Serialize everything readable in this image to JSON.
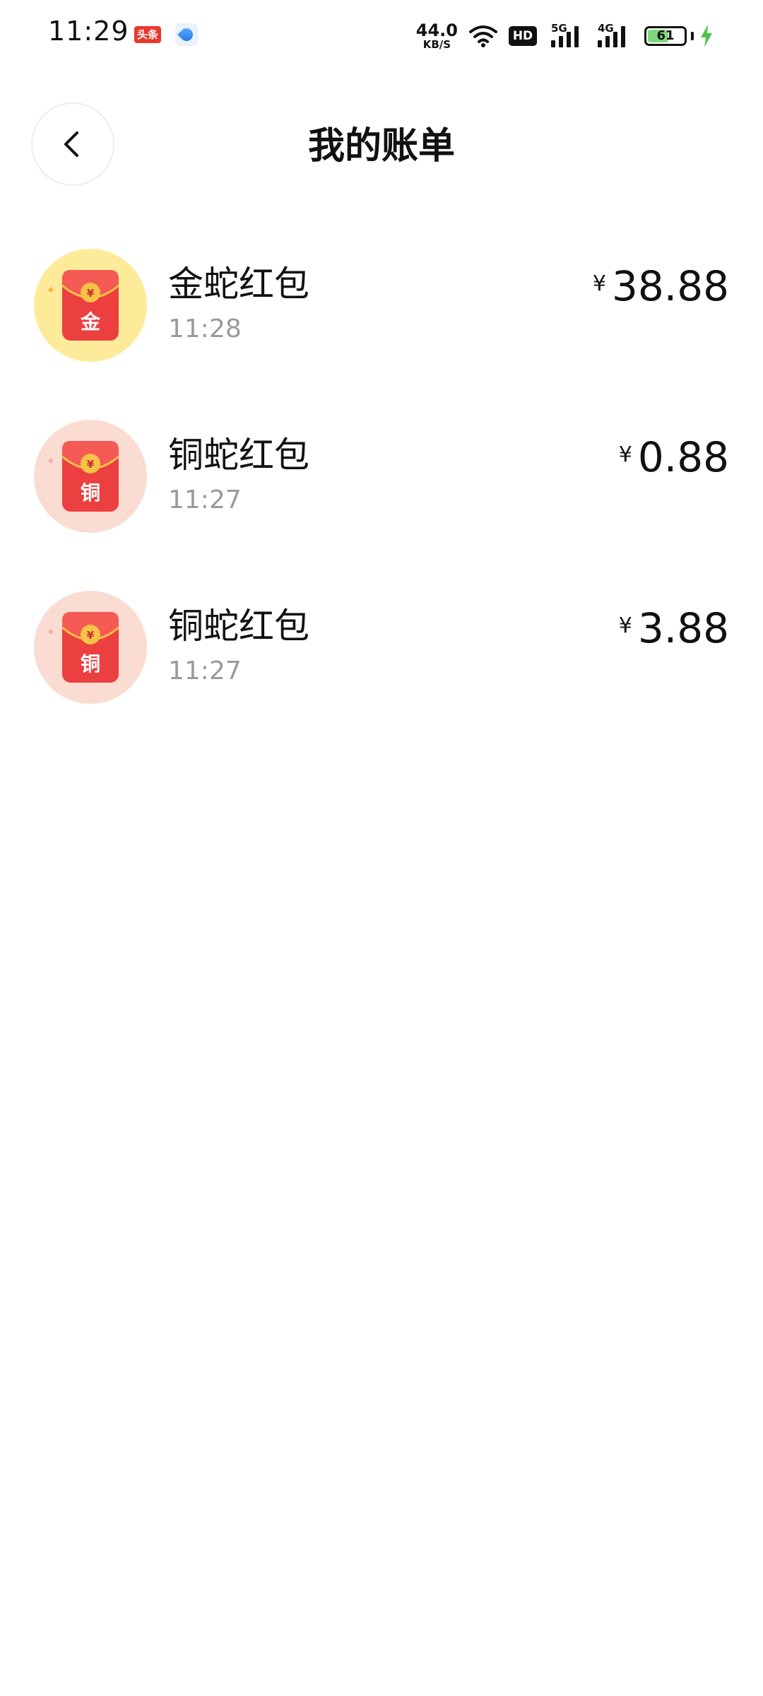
{
  "status_bar": {
    "time": "11:29",
    "news_app_label": "头条",
    "net_speed_value": "44.0",
    "net_speed_unit": "KB/S",
    "hd_label": "HD",
    "signal_1_label": "5G",
    "signal_2_label": "4G",
    "battery_level": "61",
    "battery_fraction": 0.61,
    "charging": true
  },
  "header": {
    "title": "我的账单"
  },
  "bills": [
    {
      "name": "金蛇红包",
      "time": "11:28",
      "currency": "¥",
      "amount": "38.88",
      "badge_char": "金",
      "icon_name": "gold-red-packet-icon",
      "bg_color": "#fdeb9a"
    },
    {
      "name": "铜蛇红包",
      "time": "11:27",
      "currency": "¥",
      "amount": "0.88",
      "badge_char": "铜",
      "icon_name": "copper-red-packet-icon",
      "bg_color": "#fbdcd2"
    },
    {
      "name": "铜蛇红包",
      "time": "11:27",
      "currency": "¥",
      "amount": "3.88",
      "badge_char": "铜",
      "icon_name": "copper-red-packet-icon",
      "bg_color": "#fbdcd2"
    }
  ],
  "colors": {
    "packet_red": "#ec3f3f",
    "packet_gold": "#f6c348",
    "secondary_text": "#9a9a9a"
  }
}
